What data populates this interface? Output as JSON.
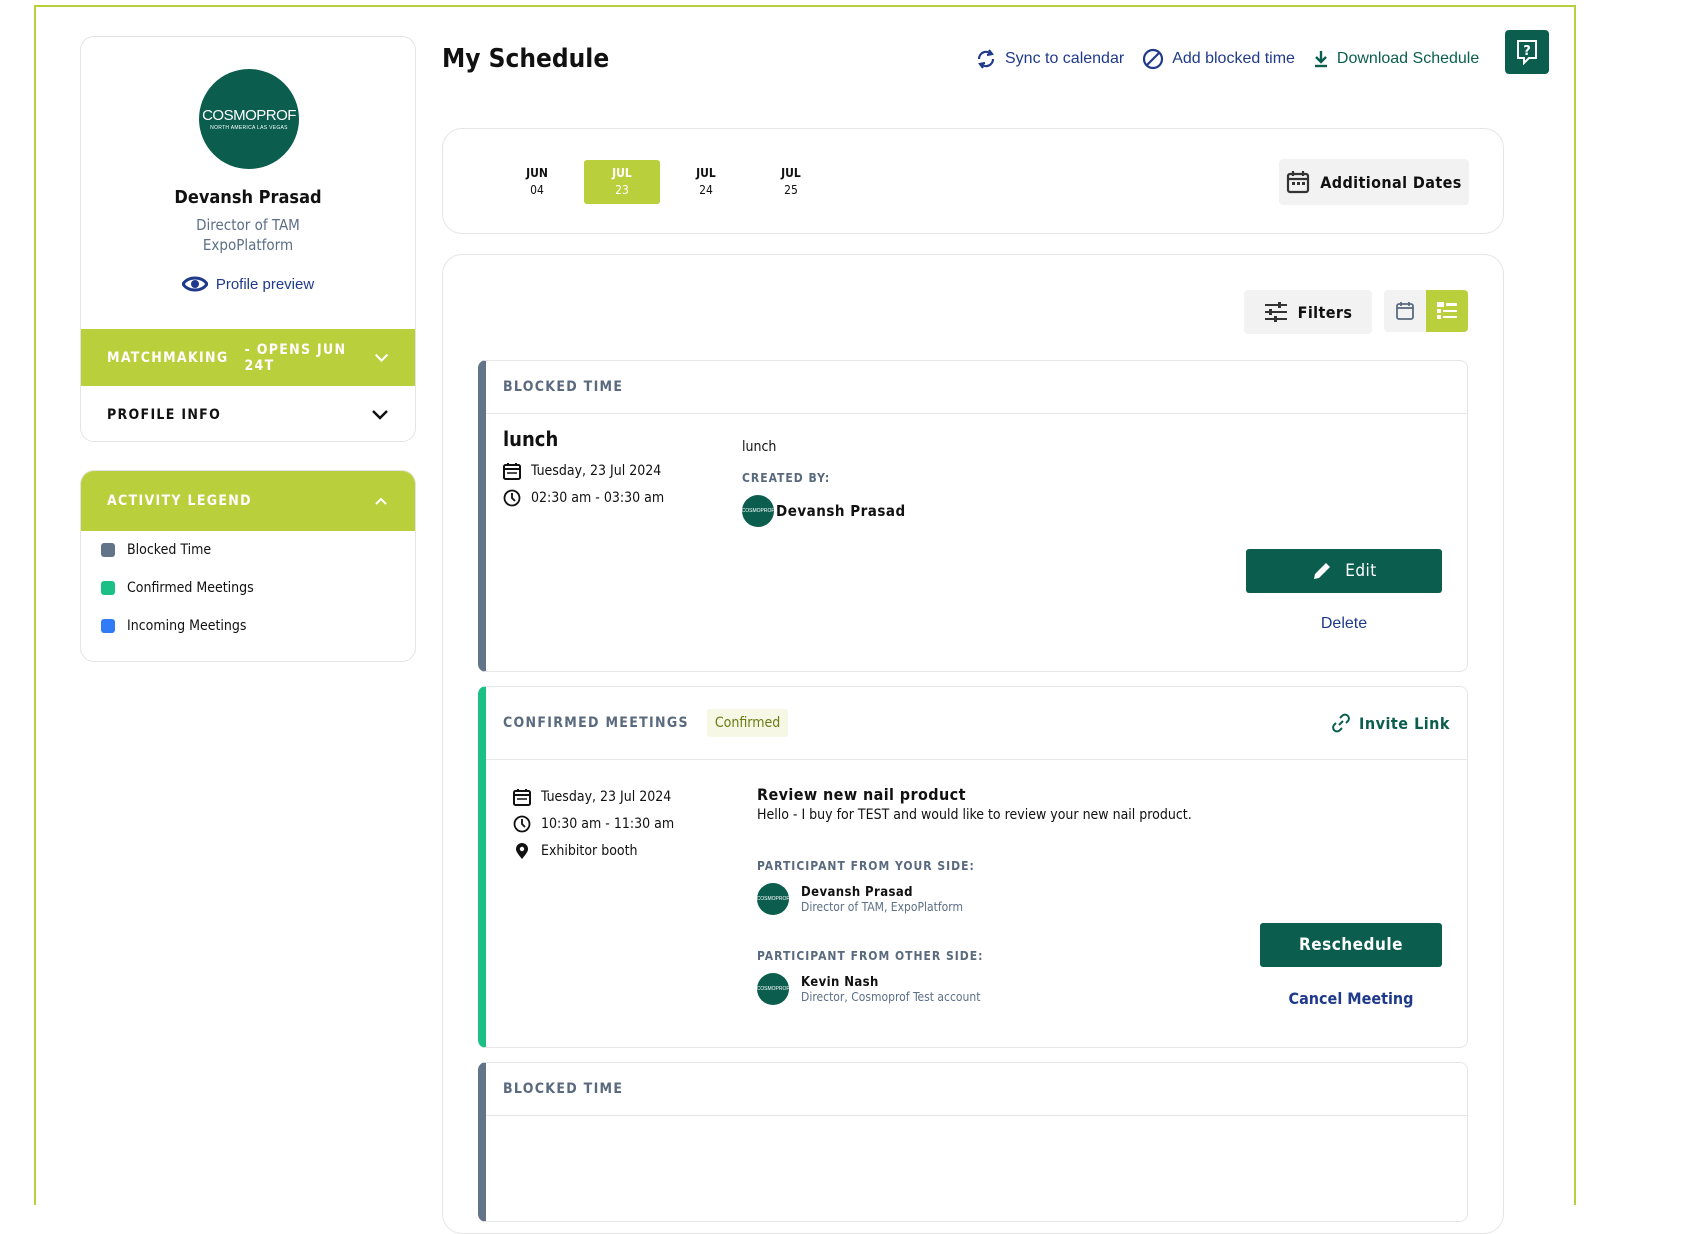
{
  "profile": {
    "logo_text": "COSMOPROF",
    "logo_sub": "NORTH AMERICA LAS VEGAS",
    "name": "Devansh Prasad",
    "role": "Director of TAM",
    "company": "ExpoPlatform",
    "preview_label": "Profile preview"
  },
  "sidebar": {
    "matchmaking_label": "MATCHMAKING",
    "matchmaking_status": "- OPENS JUN 24T",
    "profile_info_label": "PROFILE INFO"
  },
  "legend": {
    "title": "ACTIVITY LEGEND",
    "items": [
      {
        "label": "Blocked Time",
        "color": "#647488"
      },
      {
        "label": "Confirmed Meetings",
        "color": "#1cbf84"
      },
      {
        "label": "Incoming Meetings",
        "color": "#2f7cf6"
      }
    ]
  },
  "header": {
    "title": "My Schedule",
    "sync_label": "Sync to calendar",
    "block_label": "Add blocked time",
    "download_label": "Download Schedule"
  },
  "dates": [
    {
      "month": "JUN",
      "day": "04",
      "active": false
    },
    {
      "month": "JUL",
      "day": "23",
      "active": true
    },
    {
      "month": "JUL",
      "day": "24",
      "active": false
    },
    {
      "month": "JUL",
      "day": "25",
      "active": false
    }
  ],
  "additional_dates_label": "Additional Dates",
  "filters_label": "Filters",
  "blocked": {
    "section": "BLOCKED TIME",
    "title": "lunch",
    "date": "Tuesday, 23 Jul 2024",
    "time": "02:30 am - 03:30 am",
    "note": "lunch",
    "created_by_label": "CREATED BY:",
    "creator": "Devansh Prasad",
    "edit_label": "Edit",
    "delete_label": "Delete"
  },
  "confirmed": {
    "section": "CONFIRMED MEETINGS",
    "badge": "Confirmed",
    "invite_label": "Invite Link",
    "date": "Tuesday, 23 Jul 2024",
    "time": "10:30 am - 11:30 am",
    "location": "Exhibitor booth",
    "title": "Review new nail product",
    "message": "Hello - I buy for TEST and would like to review your new nail product.",
    "your_side_label": "PARTICIPANT FROM YOUR SIDE:",
    "your_name": "Devansh Prasad",
    "your_role": "Director of TAM, ExpoPlatform",
    "other_side_label": "PARTICIPANT FROM OTHER SIDE:",
    "other_name": "Kevin Nash",
    "other_role": "Director, Cosmoprof Test account",
    "reschedule_label": "Reschedule",
    "cancel_label": "Cancel Meeting"
  },
  "blocked2": {
    "section": "BLOCKED TIME"
  }
}
